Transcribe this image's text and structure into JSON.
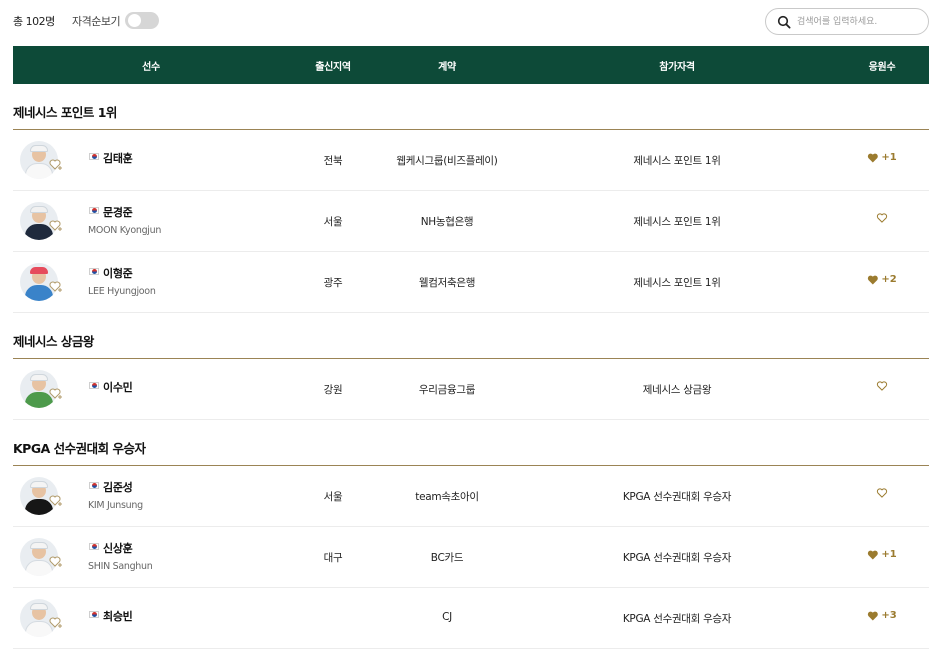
{
  "toolbar": {
    "total_label": "총 102명",
    "toggle_label": "자격순보기",
    "toggle_on": false,
    "search_placeholder": "검색어를 입력하세요."
  },
  "table": {
    "columns": [
      "선수",
      "출신지역",
      "계약",
      "참가자격",
      "응원수"
    ]
  },
  "colors": {
    "header_bg": "#0d4a38",
    "accent_gold": "#9b7b2f",
    "divider": "#9b8455"
  },
  "groups": [
    {
      "title": "제네시스 포인트 1위",
      "players": [
        {
          "name": "김태훈",
          "ename": "",
          "region": "전북",
          "contract": "웹케시그룹(비즈플레이)",
          "qualification": "제네시스 포인트 1위",
          "cheer": "+1",
          "cheered": true,
          "flag": "korea-flag-icon"
        },
        {
          "name": "문경준",
          "ename": "MOON Kyongjun",
          "region": "서울",
          "contract": "NH농협은행",
          "qualification": "제네시스 포인트 1위",
          "cheer": "",
          "cheered": false,
          "flag": "korea-flag-icon"
        },
        {
          "name": "이형준",
          "ename": "LEE Hyungjoon",
          "region": "광주",
          "contract": "웰컴저축은행",
          "qualification": "제네시스 포인트 1위",
          "cheer": "+2",
          "cheered": true,
          "flag": "korea-flag-icon"
        }
      ]
    },
    {
      "title": "제네시스 상금왕",
      "players": [
        {
          "name": "이수민",
          "ename": "",
          "region": "강원",
          "contract": "우리금융그룹",
          "qualification": "제네시스 상금왕",
          "cheer": "",
          "cheered": false,
          "flag": "korea-flag-icon"
        }
      ]
    },
    {
      "title": "KPGA 선수권대회 우승자",
      "players": [
        {
          "name": "김준성",
          "ename": "KIM Junsung",
          "region": "서울",
          "contract": "team속초아이",
          "qualification": "KPGA 선수권대회 우승자",
          "cheer": "",
          "cheered": false,
          "flag": "korea-flag-icon"
        },
        {
          "name": "신상훈",
          "ename": "SHIN Sanghun",
          "region": "대구",
          "contract": "BC카드",
          "qualification": "KPGA 선수권대회 우승자",
          "cheer": "+1",
          "cheered": true,
          "flag": "korea-flag-icon"
        },
        {
          "name": "최승빈",
          "ename": "",
          "region": "",
          "contract": "CJ",
          "qualification": "KPGA 선수권대회 우승자",
          "cheer": "+3",
          "cheered": true,
          "flag": "korea-flag-icon"
        }
      ]
    }
  ]
}
